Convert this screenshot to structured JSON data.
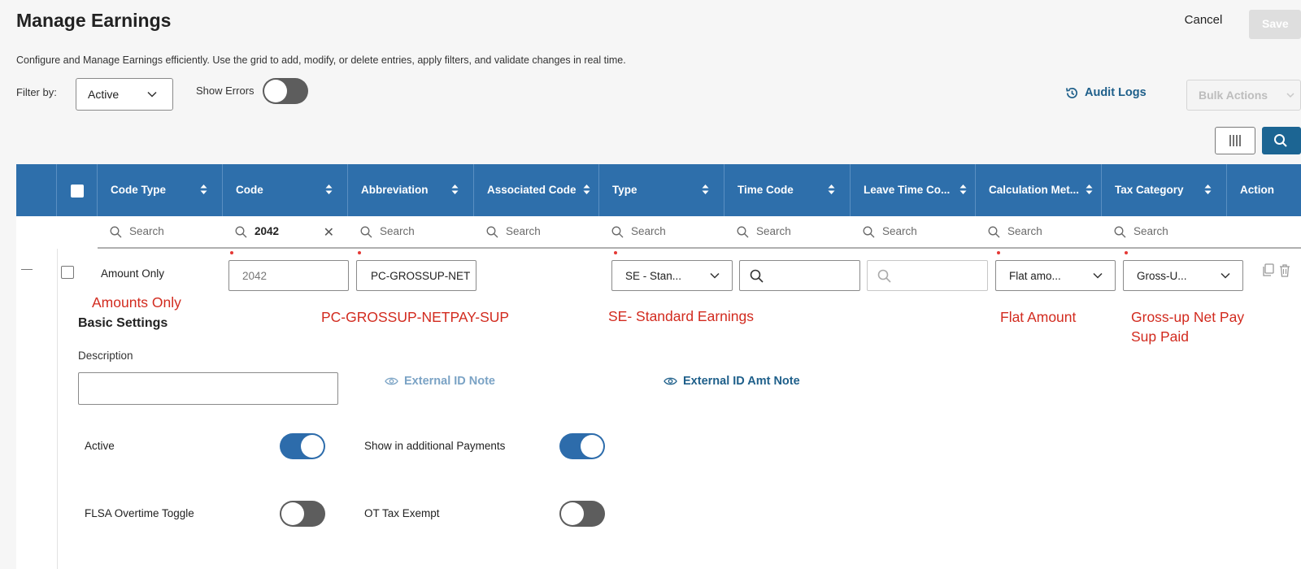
{
  "header": {
    "title": "Manage Earnings",
    "description": "Configure and Manage Earnings efficiently. Use the grid to add, modify, or delete entries, apply filters, and validate changes in real time.",
    "cancel_label": "Cancel",
    "save_label": "Save"
  },
  "filters": {
    "filter_by_label": "Filter by:",
    "filter_value": "Active",
    "show_errors_label": "Show Errors",
    "show_errors_on": false
  },
  "actions": {
    "audit_logs_label": "Audit Logs",
    "bulk_actions_label": "Bulk Actions"
  },
  "grid": {
    "columns": [
      {
        "label": "Code Type"
      },
      {
        "label": "Code"
      },
      {
        "label": "Abbreviation"
      },
      {
        "label": "Associated Code"
      },
      {
        "label": "Type"
      },
      {
        "label": "Time Code"
      },
      {
        "label": "Leave Time Co..."
      },
      {
        "label": "Calculation Met..."
      },
      {
        "label": "Tax Category"
      },
      {
        "label": "Action"
      }
    ],
    "search_placeholder": "Search",
    "code_filter_value": "2042",
    "row": {
      "code_type": "Amount Only",
      "code": "2042",
      "abbreviation": "PC-GROSSUP-NET",
      "type": "SE - Stan...",
      "calculation_method": "Flat amo...",
      "tax_category": "Gross-U..."
    }
  },
  "annotations": {
    "code_type": "Amounts Only",
    "abbreviation": "PC-GROSSUP-NETPAY-SUP",
    "type": "SE- Standard Earnings",
    "calculation": "Flat Amount",
    "tax_line1": "Gross-up Net Pay",
    "tax_line2": "Sup Paid"
  },
  "basic_settings": {
    "title": "Basic Settings",
    "description_label": "Description",
    "description_value": "",
    "external_id_note": "External ID Note",
    "external_id_amt_note": "External ID Amt Note",
    "toggles": [
      {
        "label": "Active",
        "on": true
      },
      {
        "label": "Show in additional Payments",
        "on": true
      },
      {
        "label": "FLSA Overtime Toggle",
        "on": false
      },
      {
        "label": "OT Tax Exempt",
        "on": false
      }
    ]
  },
  "colors": {
    "header_blue": "#2e6fab",
    "link_blue": "#1e5f8a",
    "annotation_red": "#d22b1f",
    "toggle_on": "#2d6cab",
    "toggle_off": "#5d5d5d"
  }
}
